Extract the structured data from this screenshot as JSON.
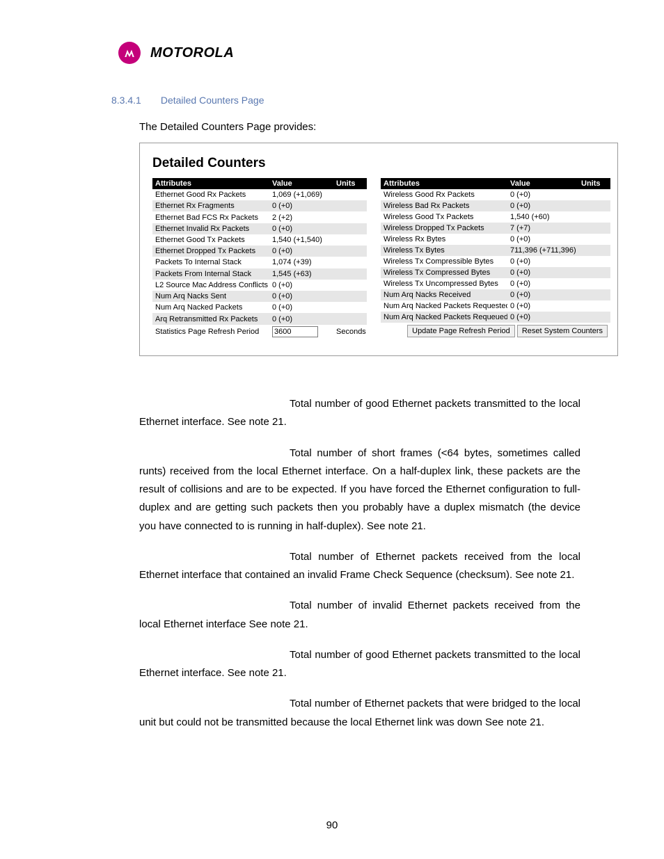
{
  "brand": "MOTOROLA",
  "section": {
    "num": "8.3.4.1",
    "title": "Detailed Counters Page"
  },
  "intro": "The Detailed Counters Page provides:",
  "panel_title": "Detailed Counters",
  "headers": {
    "attr": "Attributes",
    "val": "Value",
    "unit": "Units"
  },
  "left_rows": [
    {
      "a": "Ethernet Good Rx Packets",
      "v": "1,069 (+1,069)",
      "u": ""
    },
    {
      "a": "Ethernet Rx Fragments",
      "v": "0 (+0)",
      "u": ""
    },
    {
      "a": "Ethernet Bad FCS Rx Packets",
      "v": "2 (+2)",
      "u": ""
    },
    {
      "a": "Ethernet Invalid Rx Packets",
      "v": "0 (+0)",
      "u": ""
    },
    {
      "a": "Ethernet Good Tx Packets",
      "v": "1,540 (+1,540)",
      "u": ""
    },
    {
      "a": "Ethernet Dropped Tx Packets",
      "v": "0 (+0)",
      "u": ""
    },
    {
      "a": "Packets To Internal Stack",
      "v": "1,074 (+39)",
      "u": ""
    },
    {
      "a": "Packets From Internal Stack",
      "v": "1,545 (+63)",
      "u": ""
    },
    {
      "a": "L2 Source Mac Address Conflicts",
      "v": "0 (+0)",
      "u": ""
    },
    {
      "a": "Num Arq Nacks Sent",
      "v": "0 (+0)",
      "u": ""
    },
    {
      "a": "Num Arq Nacked Packets",
      "v": "0 (+0)",
      "u": ""
    },
    {
      "a": "Arq Retransmitted Rx Packets",
      "v": "0 (+0)",
      "u": ""
    }
  ],
  "right_rows": [
    {
      "a": "Wireless Good Rx Packets",
      "v": "0 (+0)",
      "u": ""
    },
    {
      "a": "Wireless Bad Rx Packets",
      "v": "0 (+0)",
      "u": ""
    },
    {
      "a": "Wireless Good Tx Packets",
      "v": "1,540 (+60)",
      "u": ""
    },
    {
      "a": "Wireless Dropped Tx Packets",
      "v": "7 (+7)",
      "u": ""
    },
    {
      "a": "Wireless Rx Bytes",
      "v": "0 (+0)",
      "u": ""
    },
    {
      "a": "Wireless Tx Bytes",
      "v": "711,396 (+711,396)",
      "u": ""
    },
    {
      "a": "Wireless Tx Compressible Bytes",
      "v": "0 (+0)",
      "u": ""
    },
    {
      "a": "Wireless Tx Compressed Bytes",
      "v": "0 (+0)",
      "u": ""
    },
    {
      "a": "Wireless Tx Uncompressed Bytes",
      "v": "0 (+0)",
      "u": ""
    },
    {
      "a": "Num Arq Nacks Received",
      "v": "0 (+0)",
      "u": ""
    },
    {
      "a": "Num Arq Nacked Packets Requested",
      "v": "0 (+0)",
      "u": ""
    },
    {
      "a": "Num Arq Nacked Packets Requeued",
      "v": "0 (+0)",
      "u": ""
    }
  ],
  "refresh": {
    "label": "Statistics Page Refresh Period",
    "value": "3600",
    "units": "Seconds",
    "btn_update": "Update Page Refresh Period",
    "btn_reset": "Reset System Counters"
  },
  "paras": [
    "Total number of good Ethernet packets transmitted to the local Ethernet interface. See note 21.",
    "Total number of short frames (<64 bytes, sometimes called runts) received from the local Ethernet interface. On a half-duplex link, these packets are the result of collisions and are to be expected. If you have forced the Ethernet configuration to full-duplex and are getting such packets then you probably have a duplex mismatch (the device you have connected to is running in half-duplex). See note 21.",
    "Total number of Ethernet packets received from the local Ethernet interface that contained an invalid Frame Check Sequence (checksum). See note 21.",
    "Total number of invalid Ethernet packets received from the local Ethernet interface See note 21.",
    "Total number of good Ethernet packets transmitted to the local Ethernet interface. See note 21.",
    "Total number of Ethernet packets that were bridged to the local unit but could not be transmitted because the local Ethernet link was down See note 21."
  ],
  "page_number": "90"
}
